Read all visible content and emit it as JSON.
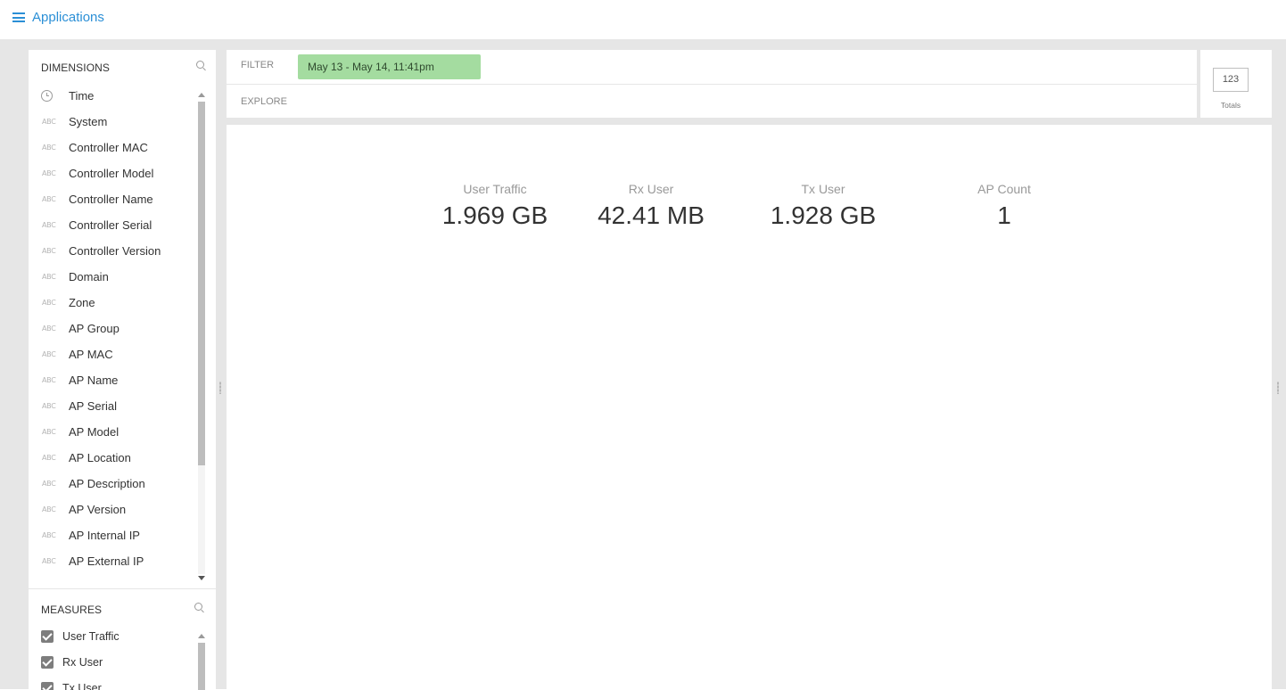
{
  "header": {
    "menu_icon": "hamburger-menu-icon",
    "title": "Applications"
  },
  "dimensions": {
    "heading": "DIMENSIONS",
    "search_icon": "search-icon",
    "items": [
      {
        "label": "Time",
        "type_icon": "clock-icon"
      },
      {
        "label": "System",
        "type_icon": "abc"
      },
      {
        "label": "Controller MAC",
        "type_icon": "abc"
      },
      {
        "label": "Controller Model",
        "type_icon": "abc"
      },
      {
        "label": "Controller Name",
        "type_icon": "abc"
      },
      {
        "label": "Controller Serial",
        "type_icon": "abc"
      },
      {
        "label": "Controller Version",
        "type_icon": "abc"
      },
      {
        "label": "Domain",
        "type_icon": "abc"
      },
      {
        "label": "Zone",
        "type_icon": "abc"
      },
      {
        "label": "AP Group",
        "type_icon": "abc"
      },
      {
        "label": "AP MAC",
        "type_icon": "abc"
      },
      {
        "label": "AP Name",
        "type_icon": "abc"
      },
      {
        "label": "AP Serial",
        "type_icon": "abc"
      },
      {
        "label": "AP Model",
        "type_icon": "abc"
      },
      {
        "label": "AP Location",
        "type_icon": "abc"
      },
      {
        "label": "AP Description",
        "type_icon": "abc"
      },
      {
        "label": "AP Version",
        "type_icon": "abc"
      },
      {
        "label": "AP Internal IP",
        "type_icon": "abc"
      },
      {
        "label": "AP External IP",
        "type_icon": "abc"
      }
    ],
    "type_glyph": "ABC"
  },
  "measures": {
    "heading": "MEASURES",
    "search_icon": "search-icon",
    "items": [
      {
        "label": "User Traffic",
        "checked": true
      },
      {
        "label": "Rx User",
        "checked": true
      },
      {
        "label": "Tx User",
        "checked": true
      }
    ]
  },
  "filter": {
    "label": "FILTER",
    "chip": "May 13 - May 14, 11:41pm",
    "chip_color": "#a4dca0"
  },
  "explore": {
    "label": "EXPLORE"
  },
  "visualization": {
    "icon_text": "123",
    "label": "Totals"
  },
  "totals": [
    {
      "label": "User Traffic",
      "value": "1.969 GB"
    },
    {
      "label": "Rx User",
      "value": "42.41 MB"
    },
    {
      "label": "Tx User",
      "value": "1.928 GB"
    },
    {
      "label": "AP Count",
      "value": "1"
    }
  ],
  "colors": {
    "accent": "#2b8fd6",
    "workspace_bg": "#e6e6e6"
  }
}
